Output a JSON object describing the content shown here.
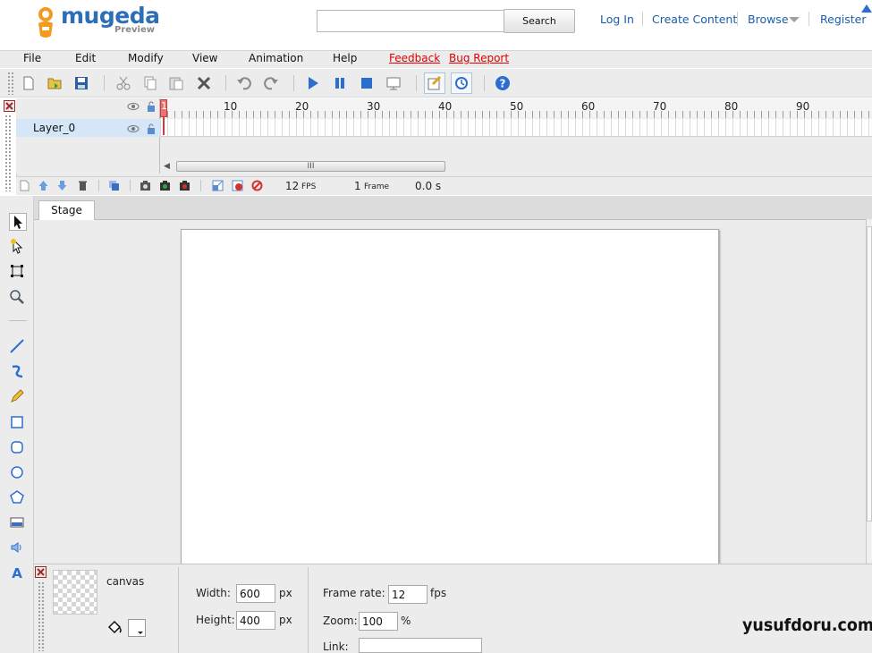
{
  "header": {
    "logo_name": "mugeda",
    "logo_sub": "Preview",
    "search_button": "Search",
    "nav": [
      "Log In",
      "Create Content",
      "Browse",
      "Register"
    ]
  },
  "menu": {
    "items": [
      "File",
      "Edit",
      "Modify",
      "View",
      "Animation",
      "Help"
    ],
    "red_links": [
      "Feedback",
      "Bug Report"
    ]
  },
  "timeline": {
    "layer_name": "Layer_0",
    "ruler_numbers": [
      "1",
      "10",
      "20",
      "30",
      "40",
      "50",
      "60",
      "70",
      "80",
      "90"
    ],
    "scroll_label": "III",
    "fps_value": "12",
    "fps_unit": "FPS",
    "frame_value": "1",
    "frame_unit": "Frame",
    "time": "0.0 s"
  },
  "stage": {
    "tab_label": "Stage"
  },
  "properties": {
    "object_name": "canvas",
    "width_label": "Width:",
    "width_value": "600",
    "height_label": "Height:",
    "height_value": "400",
    "unit_px": "px",
    "frame_rate_label": "Frame rate:",
    "frame_rate_value": "12",
    "frame_rate_unit": "fps",
    "zoom_label": "Zoom:",
    "zoom_value": "100",
    "zoom_unit": "%",
    "link_label": "Link:"
  },
  "watermark": "yusufdoru.com",
  "colors": {
    "brand_blue": "#2c6fb7",
    "link_blue": "#1a5fa8",
    "menu_red": "#e00000",
    "layer_highlight": "#d4e6f8"
  }
}
